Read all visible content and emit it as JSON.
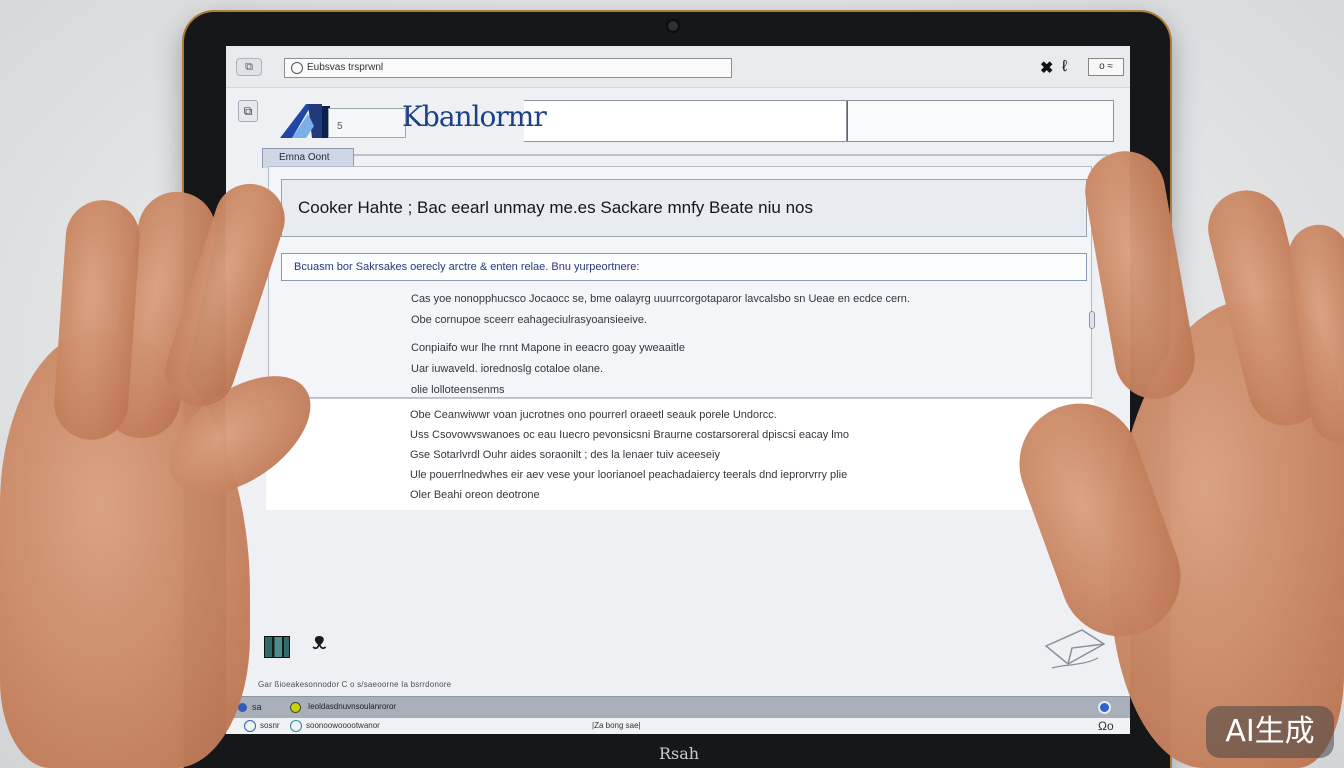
{
  "browser": {
    "back_label": "⧉",
    "address": "Eubsvas trsprwnl",
    "close_glyph": "✖",
    "toggle_glyph": "ℓ",
    "box_label": "o ≈"
  },
  "header": {
    "side_label": "⧉",
    "logo_card_text": "5",
    "logo_text": "Kbanlormr",
    "tab_label": "Emna Oont"
  },
  "main": {
    "heading": "Cooker Hahte ; Bac eearl unmay me.es Sackare mnfy Beate niu nos",
    "banner": "Bcuasm bor Sakrsakes oerecly arctre & enten relae. Bnu yurpeortnere:",
    "lines": [
      "Cas yoe nonopphucsco Jocaocc se, bme oalayrg uuurrcorgotaparor lavcalsbo sn Ueae en ecdce cern.",
      "Obe cornupoe sceerr eahageciulrasyoansieeive.",
      "Conpiaifo wur lhe rnnt Mapone in eeacro goay yweaaitle",
      "Uar iuwaveld. iorednoslg cotaloe olane.",
      "olie lolloteensenms"
    ],
    "lower_lines": [
      "Obe Ceanwiwwr voan jucrotnes ono pourrerl oraeetl seauk porele Undorcc.",
      "Uss Csovowvswanoes oc eau Iuecro pevonsicsni Braurne costarsoreral dpiscsi eacay lmo",
      "Gse Sotarlvrdl Ouhr aides soraonilt ; des la lenaer tuiv aceeseiy",
      "Ule pouerrlnedwhes eir aev vese your loorianoel peachadaiercy teerals dnd ieprorvrry plie",
      "Oler Beahi oreon deotrone"
    ]
  },
  "footer": {
    "footnote": "Gar   ßioeakesonnodor   C   o s/saeoorne   Ia   bsrrdonore",
    "status1_left": "sa",
    "status1_text": "Ieoldasdnuvnsoulanroror",
    "status2_t1": "sosnr",
    "status2_t2": "soonoowooootwanor",
    "status2_t3": "|Za bong sae|",
    "status2_t4": "Ωo"
  },
  "device": {
    "brand": "Rsah"
  },
  "watermark": {
    "text": "AI生成"
  },
  "colors": {
    "accent": "#1d3f86",
    "bezel": "#161719",
    "screen": "#eef0f3"
  }
}
